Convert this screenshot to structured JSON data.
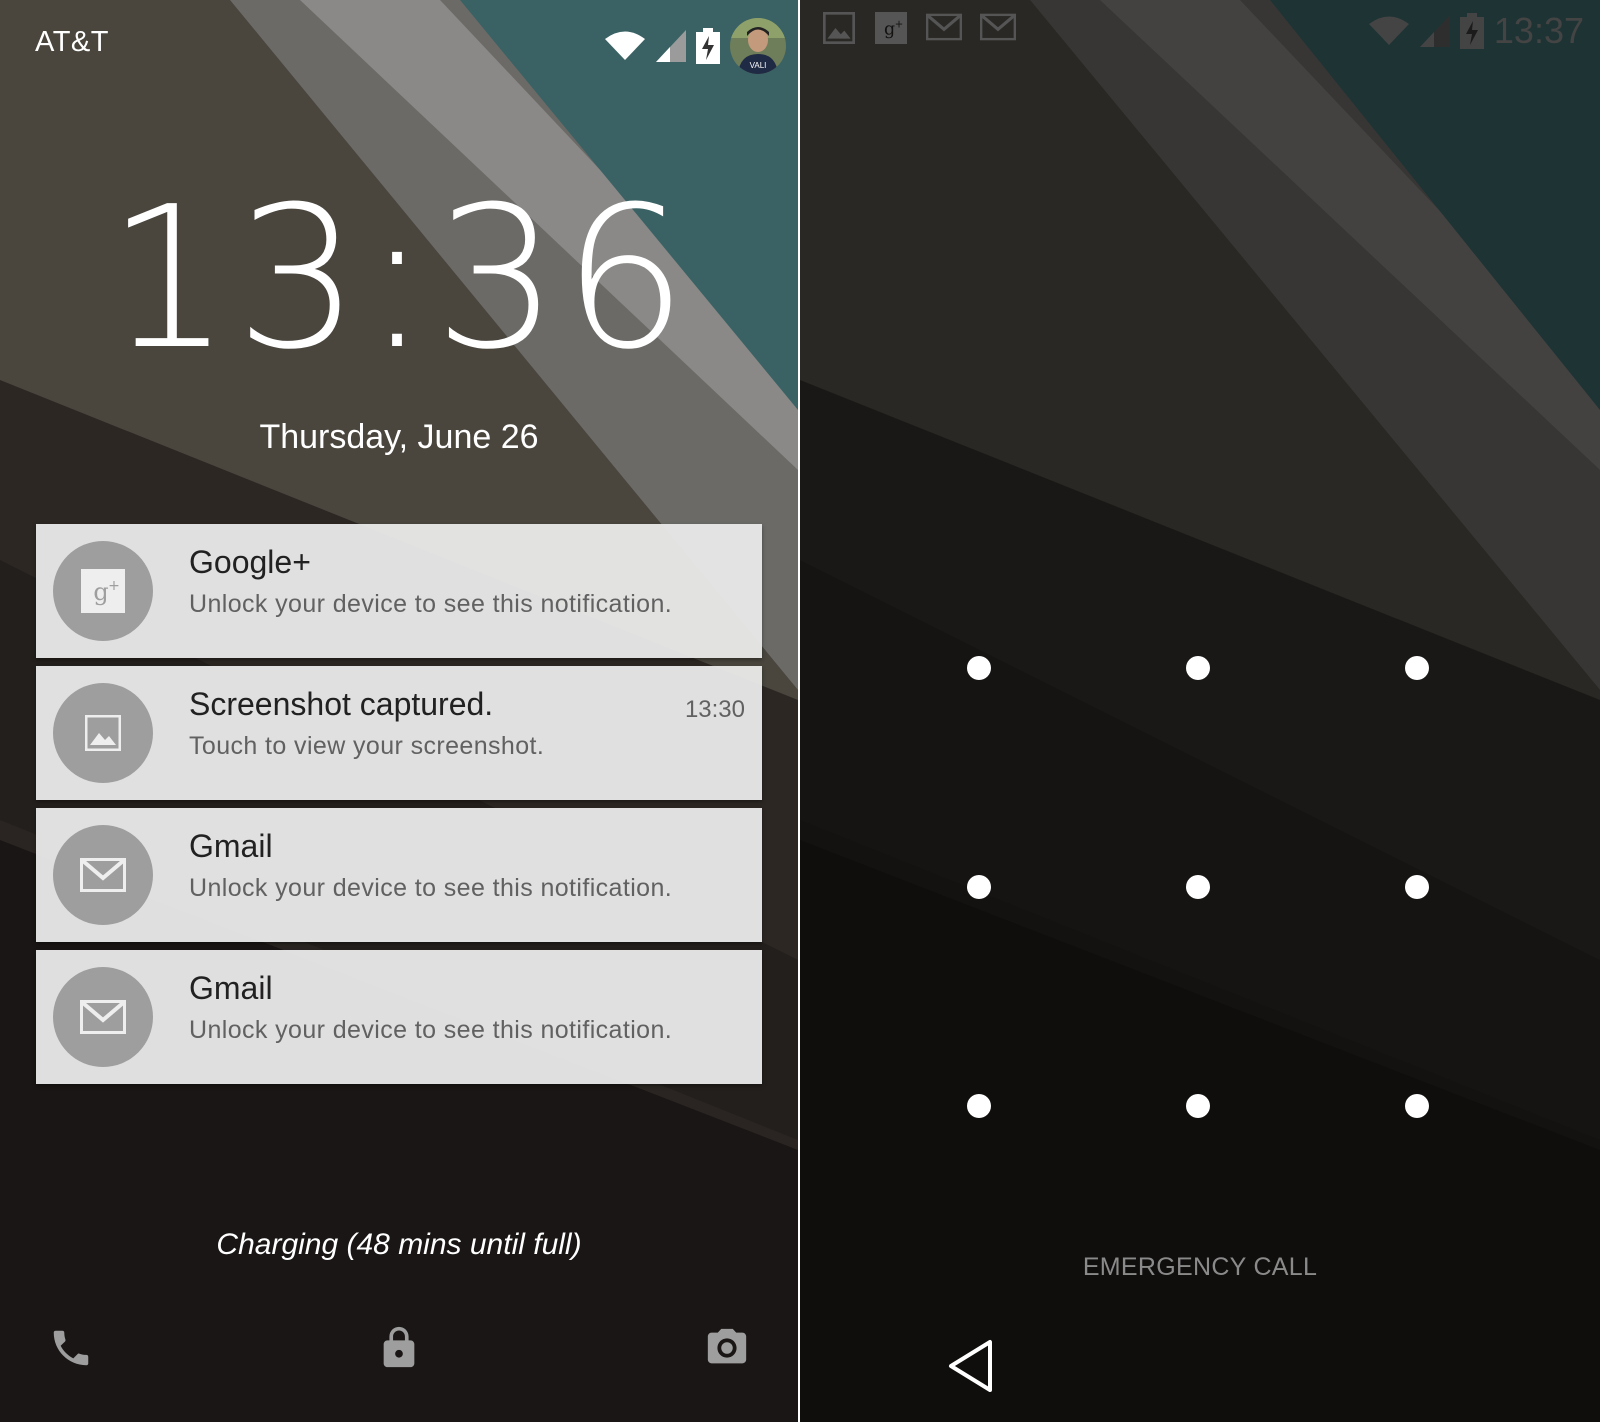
{
  "lockscreen": {
    "carrier": "AT&T",
    "time": "13:36",
    "date": "Thursday, June 26",
    "notifications": [
      {
        "app": "Google+",
        "text": "Unlock your device to see this notification.",
        "time": "",
        "icon": "google-plus-icon"
      },
      {
        "app": "Screenshot captured.",
        "text": "Touch to view your screenshot.",
        "time": "13:30",
        "icon": "image-icon"
      },
      {
        "app": "Gmail",
        "text": "Unlock your device to see this notification.",
        "time": "",
        "icon": "gmail-icon"
      },
      {
        "app": "Gmail",
        "text": "Unlock your device to see this notification.",
        "time": "",
        "icon": "gmail-icon"
      }
    ],
    "charging": "Charging (48 mins until full)",
    "bottom_icons": [
      "phone-icon",
      "lock-icon",
      "camera-icon"
    ]
  },
  "unlock_screen": {
    "time": "13:37",
    "status_icons": [
      "image-icon",
      "google-plus-icon",
      "gmail-icon",
      "gmail-icon"
    ],
    "emergency": "EMERGENCY CALL",
    "pattern_dots": 9
  },
  "colors": {
    "teal": "#3a6264",
    "notification_bg": "#e8e8e8",
    "icon_circle": "#9e9e9e"
  }
}
